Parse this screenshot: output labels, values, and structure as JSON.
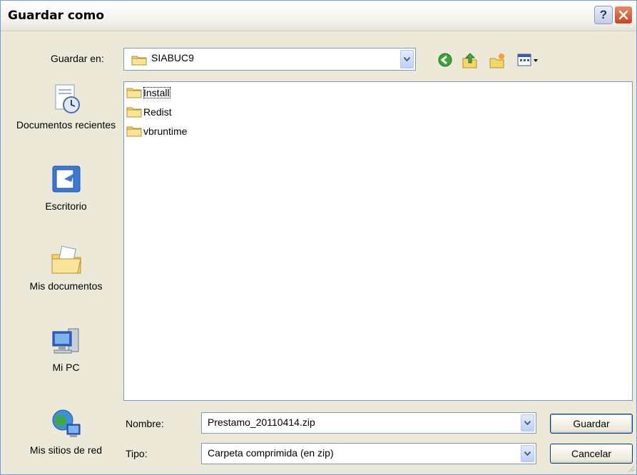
{
  "window": {
    "title": "Guardar como"
  },
  "toolbar": {
    "save_in_label": "Guardar en:",
    "location": "SIABUC9"
  },
  "places": [
    {
      "label": "Documentos recientes",
      "icon": "recent-documents-icon"
    },
    {
      "label": "Escritorio",
      "icon": "desktop-icon"
    },
    {
      "label": "Mis documentos",
      "icon": "my-documents-icon"
    },
    {
      "label": "Mi PC",
      "icon": "my-computer-icon"
    },
    {
      "label": "Mis sitios de red",
      "icon": "network-places-icon"
    }
  ],
  "files": [
    {
      "name": "Install"
    },
    {
      "name": "Redist"
    },
    {
      "name": "vbruntime"
    }
  ],
  "form": {
    "name_label": "Nombre:",
    "name_value": "Prestamo_20110414.zip",
    "type_label": "Tipo:",
    "type_value": "Carpeta comprimida (en zip)"
  },
  "buttons": {
    "save": "Guardar",
    "cancel": "Cancelar"
  },
  "colors": {
    "folder": "#f5d66b",
    "titlebar_close": "#c9421f",
    "accent": "#7f9db9"
  }
}
